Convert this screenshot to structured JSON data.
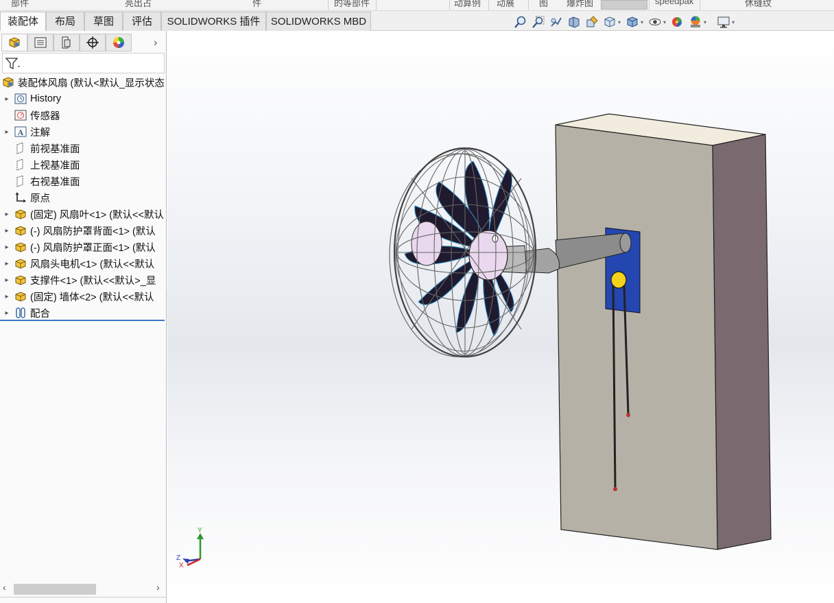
{
  "ribbon_strip": {
    "items": [
      "部件",
      "亮出占",
      "件",
      "的等部件",
      "动算例",
      "动展",
      "图",
      "爆炸图",
      "speedpak",
      "休缝纹"
    ]
  },
  "command_tabs": [
    "装配体",
    "布局",
    "草图",
    "评估",
    "SOLIDWORKS 插件",
    "SOLIDWORKS MBD"
  ],
  "active_tab": "装配体",
  "view_toolbar": {
    "icons": [
      "zoom-to-fit-icon",
      "zoom-area-icon",
      "previous-view-icon",
      "section-view-icon",
      "dynamic-annotation-icon",
      "view-orientation-icon",
      "display-style-icon",
      "hide-show-icon",
      "edit-appearance-icon",
      "apply-scene-icon",
      "view-settings-icon"
    ]
  },
  "panel_tabs": [
    "featuremanager-tab",
    "propertymanager-tab",
    "configurationmanager-tab",
    "dimxpert-tab",
    "displaymanager-tab"
  ],
  "tree": {
    "root": "装配体风扇  (默认<默认_显示状态",
    "items": [
      {
        "label": "History",
        "icon": "history-icon",
        "expandable": true
      },
      {
        "label": "传感器",
        "icon": "sensor-icon",
        "expandable": false
      },
      {
        "label": "注解",
        "icon": "annotation-icon",
        "expandable": true
      },
      {
        "label": "前视基准面",
        "icon": "plane-icon",
        "expandable": false
      },
      {
        "label": "上视基准面",
        "icon": "plane-icon",
        "expandable": false
      },
      {
        "label": "右视基准面",
        "icon": "plane-icon",
        "expandable": false
      },
      {
        "label": "原点",
        "icon": "origin-icon",
        "expandable": false
      },
      {
        "label": "(固定) 风扇叶<1> (默认<<默认",
        "icon": "part-icon",
        "expandable": true
      },
      {
        "label": "(-) 风扇防护罩背面<1> (默认",
        "icon": "part-icon",
        "expandable": true
      },
      {
        "label": "(-) 风扇防护罩正面<1> (默认",
        "icon": "part-icon",
        "expandable": true
      },
      {
        "label": "风扇头电机<1> (默认<<默认",
        "icon": "part-icon",
        "expandable": true
      },
      {
        "label": "支撑件<1> (默认<<默认>_显",
        "icon": "part-icon",
        "expandable": true
      },
      {
        "label": "(固定) 墙体<2> (默认<<默认",
        "icon": "part-icon",
        "expandable": true
      },
      {
        "label": "配合",
        "icon": "mates-icon",
        "expandable": true
      }
    ]
  },
  "triad": {
    "x": "X",
    "y": "Y",
    "z": "Z"
  },
  "colors": {
    "wall_front": "#b5b1a7",
    "wall_side": "#7a6a70",
    "wall_top": "#f1ecdd",
    "mount_plate": "#2346b0",
    "button": "#f2d21a",
    "blade": "#1f1a2e",
    "arm": "#8c8c8c"
  }
}
